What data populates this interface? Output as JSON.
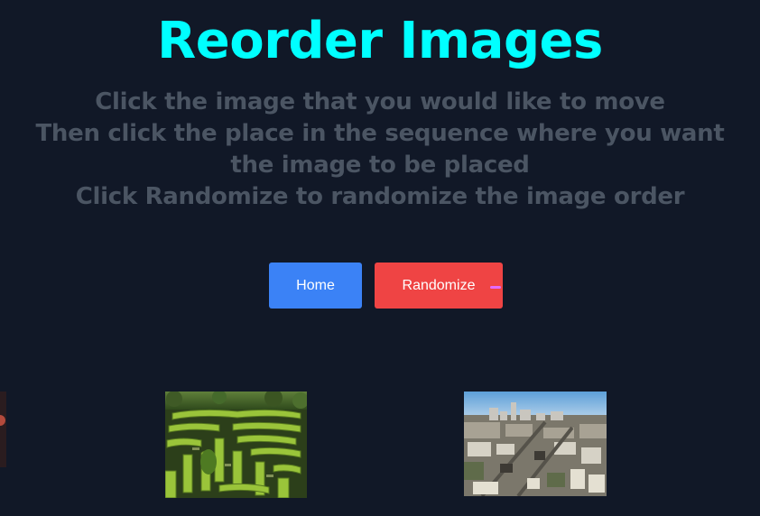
{
  "header": {
    "title": "Reorder Images"
  },
  "instructions": {
    "lines": [
      "Click the image that you would like to move",
      "Then click the place in the sequence where you want",
      "the image to be placed",
      "Click Randomize to randomize the image order"
    ]
  },
  "buttons": {
    "home_label": "Home",
    "randomize_label": "Randomize"
  },
  "colors": {
    "background": "#111827",
    "title": "#00ffff",
    "instruction_text": "#4b5563",
    "home_button": "#3b82f6",
    "randomize_button": "#ef4444"
  },
  "images": [
    {
      "subject": "partial-dark-image"
    },
    {
      "subject": "hedge-maze"
    },
    {
      "subject": "city-aerial"
    }
  ]
}
